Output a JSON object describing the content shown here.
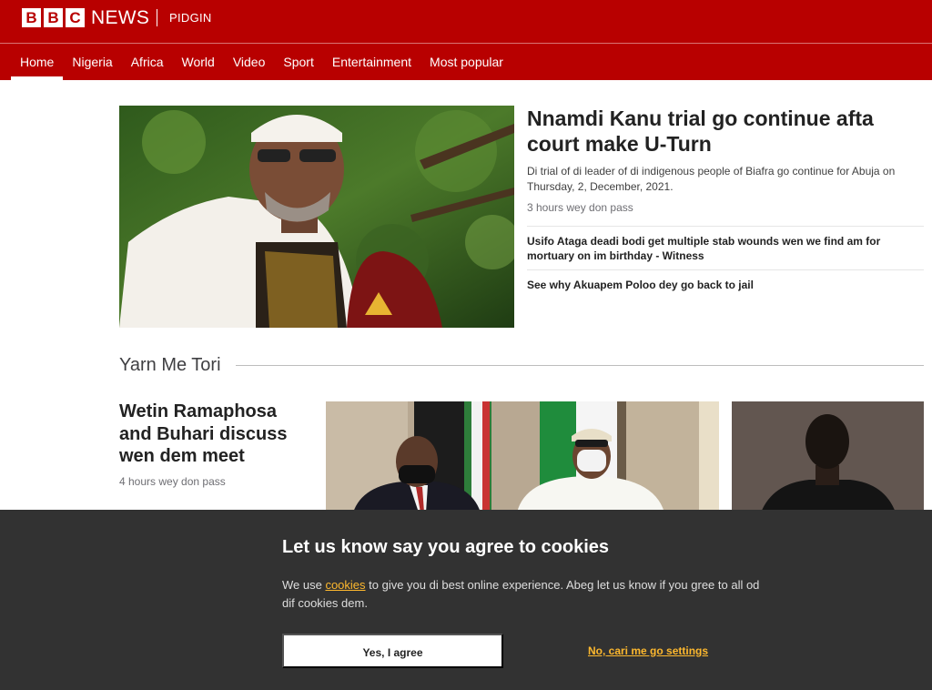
{
  "header": {
    "brand_letters": [
      "B",
      "B",
      "C"
    ],
    "brand_word": "NEWS",
    "service": "PIDGIN"
  },
  "nav": {
    "items": [
      {
        "label": "Home",
        "active": true
      },
      {
        "label": "Nigeria"
      },
      {
        "label": "Africa"
      },
      {
        "label": "World"
      },
      {
        "label": "Video"
      },
      {
        "label": "Sport"
      },
      {
        "label": "Entertainment"
      },
      {
        "label": "Most popular"
      }
    ]
  },
  "top_story": {
    "headline": "Nnamdi Kanu trial go continue afta court make U-Turn",
    "summary": "Di trial of di leader of di indigenous people of Biafra go continue for Abuja on Thursday, 2, December, 2021.",
    "time": "3 hours wey don pass",
    "related": [
      "Usifo Ataga deadi bodi get multiple stab wounds wen we find am for mortuary on im birthday - Witness",
      "See why Akuapem Poloo dey go back to jail"
    ]
  },
  "section": {
    "title": "Yarn Me Tori",
    "story": {
      "headline": "Wetin Ramaphosa and Buhari discuss wen dem meet",
      "time": "4 hours wey don pass"
    }
  },
  "cookie_banner": {
    "title": "Let us know say you agree to cookies",
    "body_before": "We use ",
    "body_link": "cookies",
    "body_after": " to give you di best online experience. Abeg let us know if you gree to all od dif cookies dem.",
    "agree_label": "Yes, I agree",
    "settings_label": "No, cari me go settings"
  },
  "colors": {
    "brand_red": "#b80000",
    "banner_bg": "#323232",
    "link_amber": "#fdb82e"
  }
}
